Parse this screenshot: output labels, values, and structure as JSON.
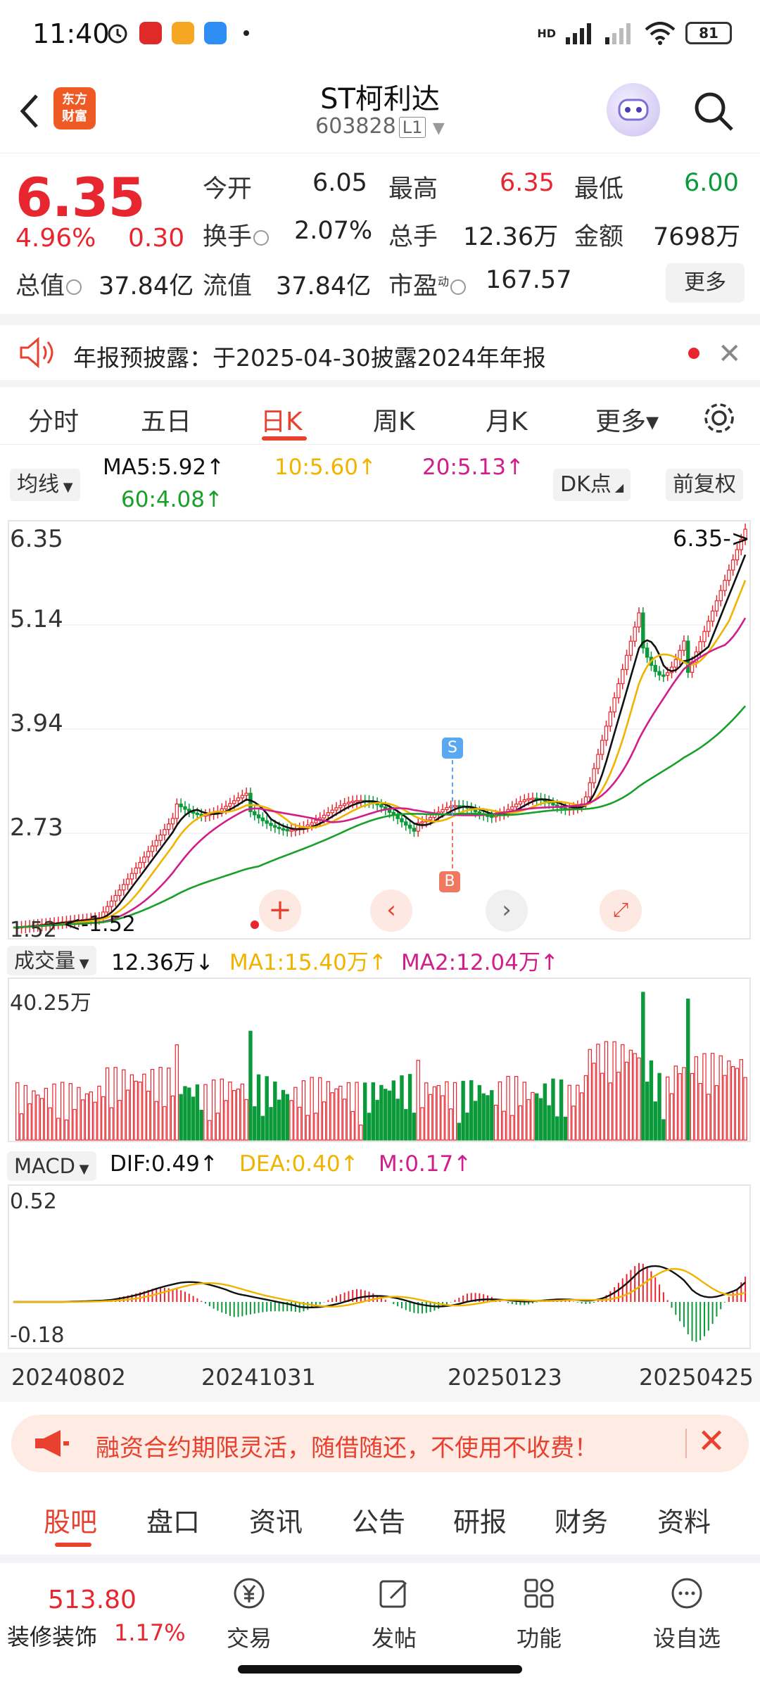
{
  "status": {
    "time": "11:40",
    "hd": "HD",
    "battery": "81"
  },
  "header": {
    "logo_line1": "东方",
    "logo_line2": "财富",
    "title": "ST柯利达",
    "code": "603828",
    "level": "L1"
  },
  "quote": {
    "price": "6.35",
    "pct": "4.96%",
    "change": "0.30",
    "rows": [
      [
        {
          "label": "今开",
          "value": "6.05",
          "color": "normal"
        },
        {
          "label": "最高",
          "value": "6.35",
          "color": "red"
        },
        {
          "label": "最低",
          "value": "6.00",
          "color": "green"
        }
      ],
      [
        {
          "label": "换手",
          "value": "2.07%",
          "color": "normal"
        },
        {
          "label": "总手",
          "value": "12.36万",
          "color": "normal"
        },
        {
          "label": "金额",
          "value": "7698万",
          "color": "normal"
        }
      ]
    ],
    "total_value_label": "总值",
    "total_value": "37.84亿",
    "float_value_label": "流值",
    "float_value": "37.84亿",
    "pe_label": "市盈",
    "pe_sup": "动",
    "pe_value": "167.57",
    "more_label": "更多"
  },
  "notice": {
    "text": "年报预披露：于2025-04-30披露2024年年报"
  },
  "tabs": [
    {
      "label": "分时",
      "active": false
    },
    {
      "label": "五日",
      "active": false
    },
    {
      "label": "日K",
      "active": true
    },
    {
      "label": "周K",
      "active": false
    },
    {
      "label": "月K",
      "active": false
    },
    {
      "label": "更多▾",
      "active": false
    }
  ],
  "indicators": {
    "ma_selector": "均线",
    "ma5": "MA5:5.92↑",
    "ma10": "10:5.60↑",
    "ma20": "20:5.13↑",
    "ma60": "60:4.08↑",
    "dk_label": "DK点",
    "restore_label": "前复权"
  },
  "kline": {
    "y_ticks": [
      "6.35",
      "5.14",
      "3.94",
      "2.73",
      "1.52"
    ],
    "high_marker": "6.35->",
    "low_marker": "<-1.52",
    "s_marker": "S",
    "b_marker": "B"
  },
  "volume": {
    "selector": "成交量",
    "current": "12.36万↓",
    "ma1": "MA1:15.40万↑",
    "ma2": "MA2:12.04万↑",
    "max": "40.25万"
  },
  "macd": {
    "selector": "MACD",
    "dif": "DIF:0.49↑",
    "dea": "DEA:0.40↑",
    "m": "M:0.17↑",
    "top": "0.52",
    "bottom": "-0.18",
    "dates": [
      "20240802",
      "20241031",
      "20250123",
      "20250425"
    ]
  },
  "colors": {
    "up": "#e8262f",
    "down": "#0a9a3a",
    "ma5": "#111111",
    "ma10": "#f0b400",
    "ma20": "#d11e8a",
    "ma60": "#18a02a",
    "accent": "#e8412f"
  },
  "ad": {
    "text": "融资合约期限灵活，随借随还，不使用不收费！"
  },
  "bottom_tabs": [
    "股吧",
    "盘口",
    "资讯",
    "公告",
    "研报",
    "财务",
    "资料"
  ],
  "bottom_bar": {
    "index_value": "513.80",
    "index_name": "装修装饰",
    "index_pct": "1.17%",
    "items": [
      {
        "label": "交易",
        "icon": "yuan-exchange-icon"
      },
      {
        "label": "发帖",
        "icon": "edit-icon"
      },
      {
        "label": "功能",
        "icon": "grid-icon"
      },
      {
        "label": "设自选",
        "icon": "more-dots-icon"
      }
    ]
  }
}
